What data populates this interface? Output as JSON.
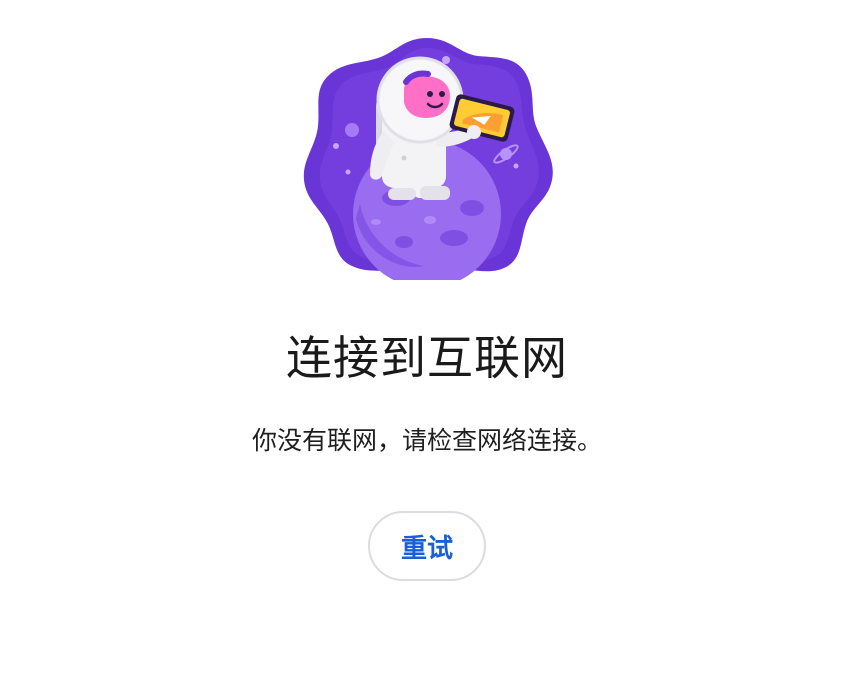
{
  "illustration": {
    "icon": "astronaut-on-moon-illustration",
    "colors": {
      "background_blob": "#6a35d6",
      "moon": "#9a6cf0",
      "helmet": "#ff6fc8",
      "tablet": "#ffcc33"
    }
  },
  "offline": {
    "title": "连接到互联网",
    "message": "你没有联网，请检查网络连接。",
    "retry_label": "重试"
  },
  "colors": {
    "title_text": "#1a1a1a",
    "button_text": "#1a5fd8",
    "button_border": "#dadce0"
  }
}
